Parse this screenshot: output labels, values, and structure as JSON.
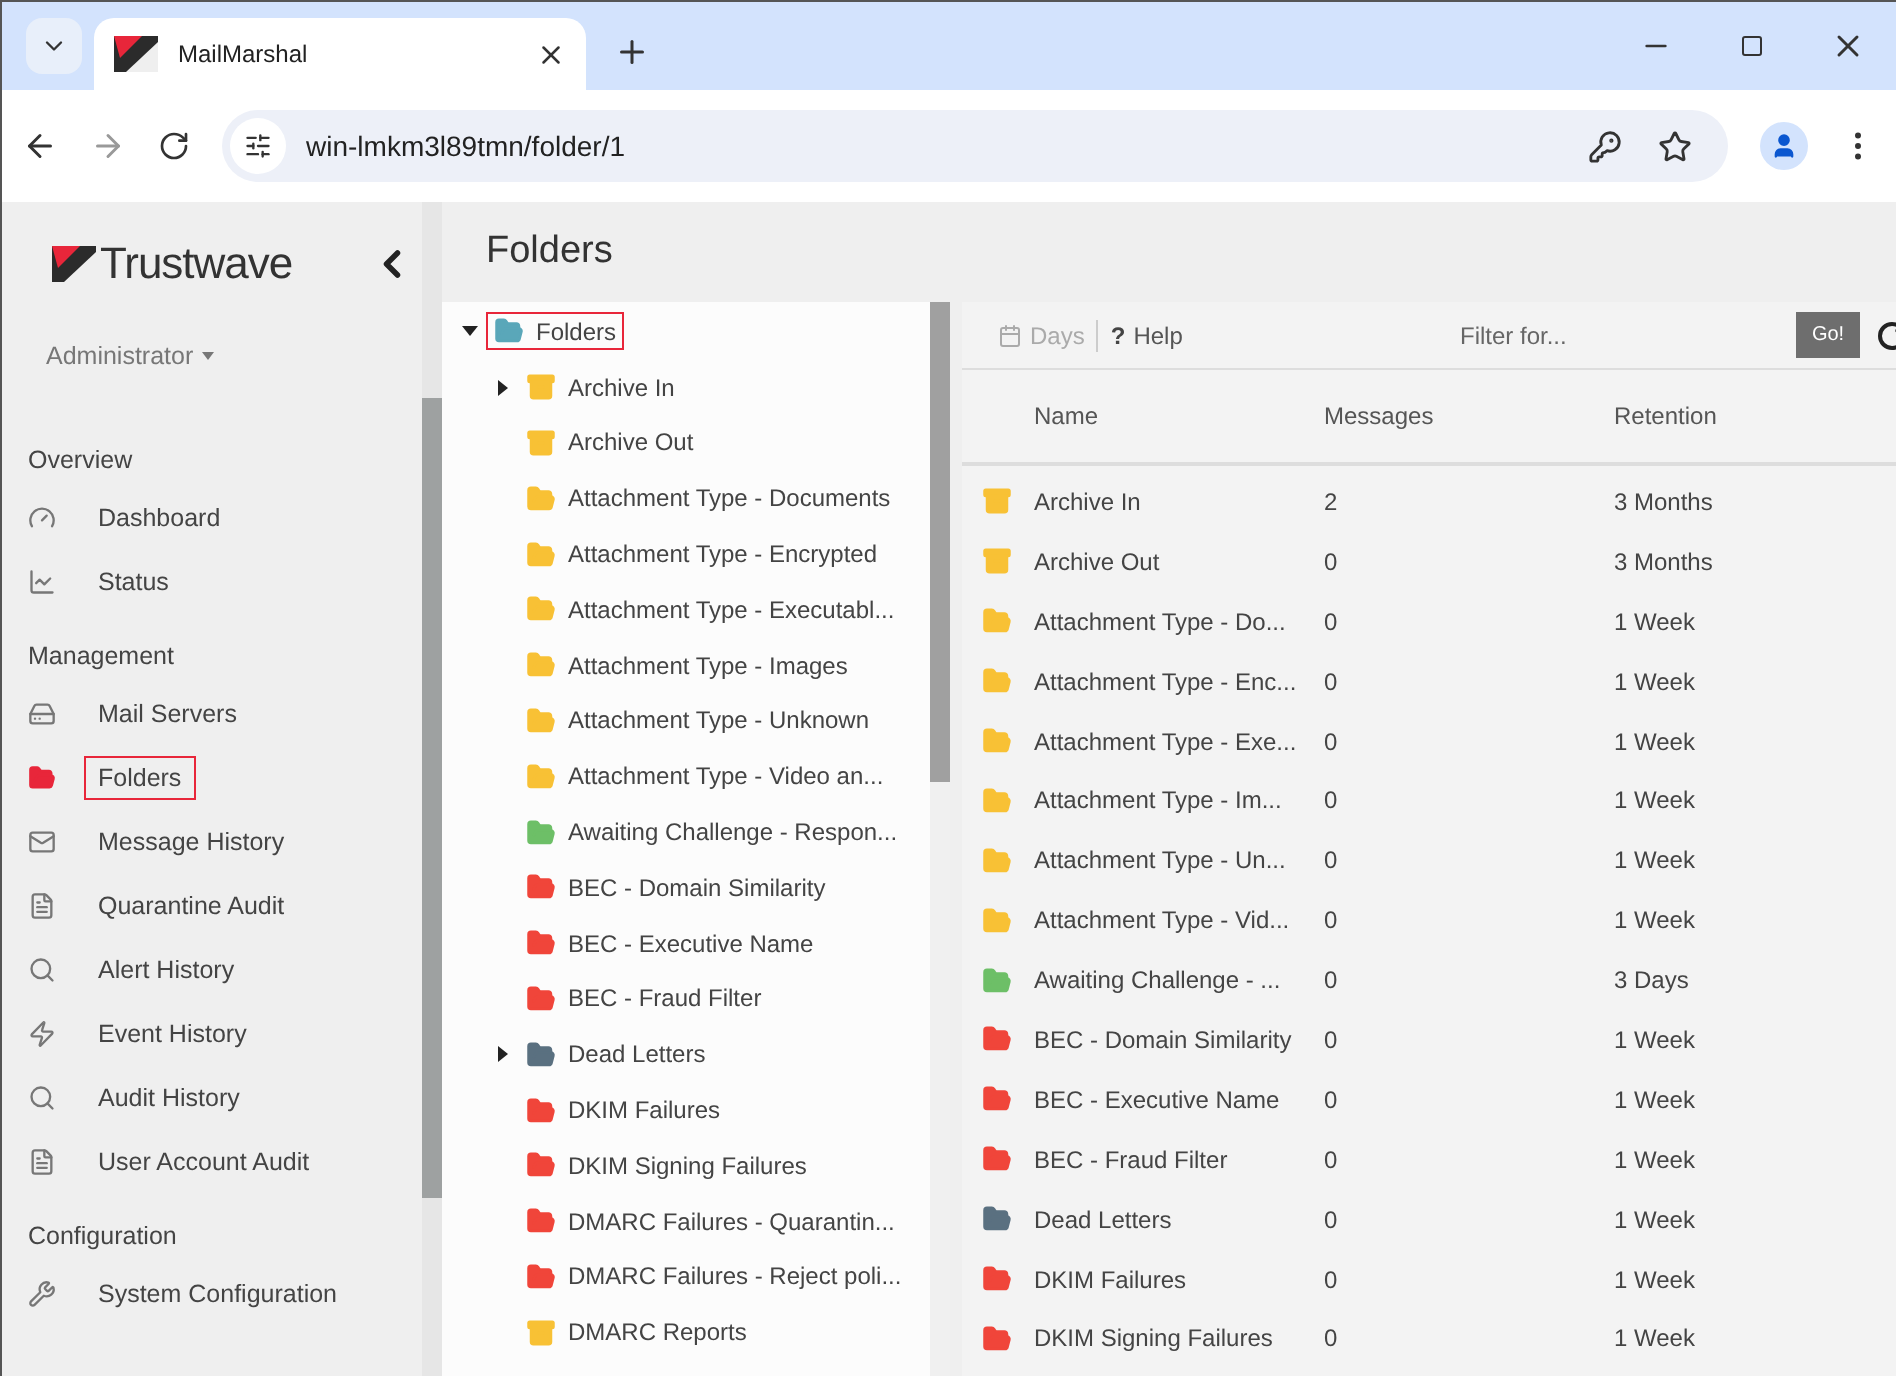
{
  "browser": {
    "tab_title": "MailMarshal",
    "url": "win-lmkm3l89tmn/folder/1"
  },
  "sidebar": {
    "logo": "Trustwave",
    "user": "Administrator",
    "sections": [
      {
        "title": "Overview",
        "items": [
          {
            "label": "Dashboard",
            "selected": false
          },
          {
            "label": "Status",
            "selected": false
          }
        ]
      },
      {
        "title": "Management",
        "items": [
          {
            "label": "Mail Servers",
            "selected": false
          },
          {
            "label": "Folders",
            "selected": true
          },
          {
            "label": "Message History",
            "selected": false
          },
          {
            "label": "Quarantine Audit",
            "selected": false
          },
          {
            "label": "Alert History",
            "selected": false
          },
          {
            "label": "Event History",
            "selected": false
          },
          {
            "label": "Audit History",
            "selected": false
          },
          {
            "label": "User Account Audit",
            "selected": false
          }
        ]
      },
      {
        "title": "Configuration",
        "items": [
          {
            "label": "System Configuration",
            "selected": false
          }
        ]
      }
    ]
  },
  "page_title": "Folders",
  "tree": {
    "label": "Folders",
    "selected": true,
    "expanded": true,
    "color": "#5aa7b9",
    "children": [
      {
        "label": "Archive In",
        "kind": "archive",
        "color": "#f8c135",
        "has_children": true
      },
      {
        "label": "Archive Out",
        "kind": "archive",
        "color": "#f8c135",
        "has_children": false
      },
      {
        "label": "Attachment Type - Documents",
        "kind": "folder",
        "color": "#f8c135",
        "has_children": false
      },
      {
        "label": "Attachment Type - Encrypted",
        "kind": "folder",
        "color": "#f8c135",
        "has_children": false
      },
      {
        "label": "Attachment Type - Executabl...",
        "kind": "folder",
        "color": "#f8c135",
        "has_children": false
      },
      {
        "label": "Attachment Type - Images",
        "kind": "folder",
        "color": "#f8c135",
        "has_children": false
      },
      {
        "label": "Attachment Type - Unknown",
        "kind": "folder",
        "color": "#f8c135",
        "has_children": false
      },
      {
        "label": "Attachment Type - Video an...",
        "kind": "folder",
        "color": "#f8c135",
        "has_children": false
      },
      {
        "label": "Awaiting Challenge - Respon...",
        "kind": "folder",
        "color": "#6dbf67",
        "has_children": false
      },
      {
        "label": "BEC - Domain Similarity",
        "kind": "folder",
        "color": "#f0453a",
        "has_children": false
      },
      {
        "label": "BEC - Executive Name",
        "kind": "folder",
        "color": "#f0453a",
        "has_children": false
      },
      {
        "label": "BEC - Fraud Filter",
        "kind": "folder",
        "color": "#f0453a",
        "has_children": false
      },
      {
        "label": "Dead Letters",
        "kind": "folder",
        "color": "#5a7080",
        "has_children": true
      },
      {
        "label": "DKIM Failures",
        "kind": "folder",
        "color": "#f0453a",
        "has_children": false
      },
      {
        "label": "DKIM Signing Failures",
        "kind": "folder",
        "color": "#f0453a",
        "has_children": false
      },
      {
        "label": "DMARC Failures - Quarantin...",
        "kind": "folder",
        "color": "#f0453a",
        "has_children": false
      },
      {
        "label": "DMARC Failures - Reject poli...",
        "kind": "folder",
        "color": "#f0453a",
        "has_children": false
      },
      {
        "label": "DMARC Reports",
        "kind": "archive",
        "color": "#f8c135",
        "has_children": false
      }
    ]
  },
  "toolbar": {
    "days": "Days",
    "days_disabled": true,
    "help_icon": "?",
    "help": "Help",
    "filter": {
      "placeholder": "Filter for..."
    },
    "go": "Go!"
  },
  "table": {
    "columns": [
      "Name",
      "Messages",
      "Retention"
    ],
    "rows": [
      {
        "kind": "archive",
        "color": "#f8c135",
        "name": "Archive In",
        "messages": "2",
        "retention": "3 Months"
      },
      {
        "kind": "archive",
        "color": "#f8c135",
        "name": "Archive Out",
        "messages": "0",
        "retention": "3 Months"
      },
      {
        "kind": "folder",
        "color": "#f8c135",
        "name": "Attachment Type - Do...",
        "messages": "0",
        "retention": "1 Week"
      },
      {
        "kind": "folder",
        "color": "#f8c135",
        "name": "Attachment Type - Enc...",
        "messages": "0",
        "retention": "1 Week"
      },
      {
        "kind": "folder",
        "color": "#f8c135",
        "name": "Attachment Type - Exe...",
        "messages": "0",
        "retention": "1 Week"
      },
      {
        "kind": "folder",
        "color": "#f8c135",
        "name": "Attachment Type - Im...",
        "messages": "0",
        "retention": "1 Week"
      },
      {
        "kind": "folder",
        "color": "#f8c135",
        "name": "Attachment Type - Un...",
        "messages": "0",
        "retention": "1 Week"
      },
      {
        "kind": "folder",
        "color": "#f8c135",
        "name": "Attachment Type - Vid...",
        "messages": "0",
        "retention": "1 Week"
      },
      {
        "kind": "folder",
        "color": "#6dbf67",
        "name": "Awaiting Challenge - ...",
        "messages": "0",
        "retention": "3 Days"
      },
      {
        "kind": "folder",
        "color": "#f0453a",
        "name": "BEC - Domain Similarity",
        "messages": "0",
        "retention": "1 Week"
      },
      {
        "kind": "folder",
        "color": "#f0453a",
        "name": "BEC - Executive Name",
        "messages": "0",
        "retention": "1 Week"
      },
      {
        "kind": "folder",
        "color": "#f0453a",
        "name": "BEC - Fraud Filter",
        "messages": "0",
        "retention": "1 Week"
      },
      {
        "kind": "folder",
        "color": "#5a7080",
        "name": "Dead Letters",
        "messages": "0",
        "retention": "1 Week"
      },
      {
        "kind": "folder",
        "color": "#f0453a",
        "name": "DKIM Failures",
        "messages": "0",
        "retention": "1 Week"
      },
      {
        "kind": "folder",
        "color": "#f0453a",
        "name": "DKIM Signing Failures",
        "messages": "0",
        "retention": "1 Week"
      }
    ]
  }
}
